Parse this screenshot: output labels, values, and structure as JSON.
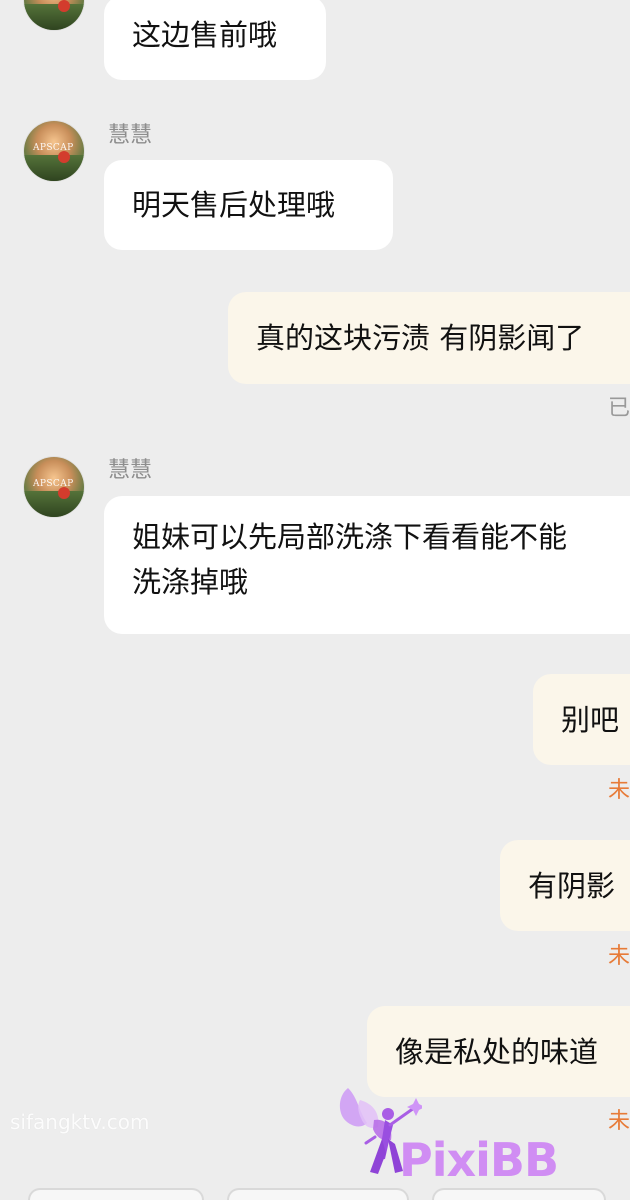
{
  "chat": {
    "messages": [
      {
        "text": "这边售前哦"
      },
      {
        "sender": "慧慧",
        "text": "明天售后处理哦",
        "avatar_label": "APSCAP"
      },
      {
        "text": "真的这块污渍 有阴影闻了",
        "status": "已"
      },
      {
        "sender": "慧慧",
        "line1": "姐妹可以先局部洗涤下看看能不能",
        "line2": "洗涤掉哦",
        "avatar_label": "APSCAP"
      },
      {
        "text": "别吧",
        "status": "未"
      },
      {
        "text": "有阴影",
        "status": "未"
      },
      {
        "text": "像是私处的味道",
        "status": "未"
      }
    ]
  },
  "watermarks": {
    "left": "sifangktv.com",
    "right": "PixiBB"
  },
  "colors": {
    "background": "#ededed",
    "left_bubble": "#ffffff",
    "right_bubble": "#fbf6ea",
    "status_gray": "#999999",
    "status_orange": "#e77b38",
    "watermark_purple": "#d08df3"
  },
  "icons": {
    "avatar": "avatar-image",
    "watermark_logo": "fairy-logo-icon"
  }
}
